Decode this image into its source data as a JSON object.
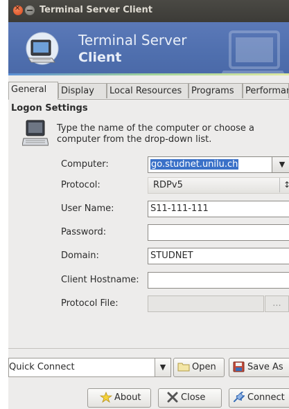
{
  "window": {
    "title": "Terminal Server Client"
  },
  "banner": {
    "line1": "Terminal Server",
    "line2": "Client"
  },
  "tabs": [
    {
      "label": "General",
      "active": true
    },
    {
      "label": "Display",
      "active": false
    },
    {
      "label": "Local Resources",
      "active": false
    },
    {
      "label": "Programs",
      "active": false
    },
    {
      "label": "Performance",
      "active": false
    }
  ],
  "logon": {
    "section_title": "Logon Settings",
    "intro": "Type the name of the computer or choose a computer from the drop-down list.",
    "computer_label": "Computer:",
    "computer_value": "go.studnet.unilu.ch",
    "protocol_label": "Protocol:",
    "protocol_value": "RDPv5",
    "username_label": "User Name:",
    "username_value": "S11-111-111",
    "password_label": "Password:",
    "password_value": "",
    "domain_label": "Domain:",
    "domain_value": "STUDNET",
    "hostname_label": "Client Hostname:",
    "hostname_value": "",
    "protocol_file_label": "Protocol File:",
    "protocol_file_value": "",
    "browse_label": "..."
  },
  "bottom": {
    "quick_connect": "Quick Connect",
    "open": "Open",
    "save_as": "Save As",
    "about": "About",
    "close": "Close",
    "connect": "Connect"
  },
  "icons": {
    "close": "close-icon",
    "minimize": "minimize-icon",
    "app": "computer-icon",
    "open": "folder-icon",
    "save": "save-icon",
    "about": "star-icon",
    "close_btn": "x-icon",
    "connect": "connect-icon"
  },
  "colors": {
    "banner": "#4f6fae",
    "selection": "#3a71c8",
    "titlebar": "#3c3b37"
  }
}
